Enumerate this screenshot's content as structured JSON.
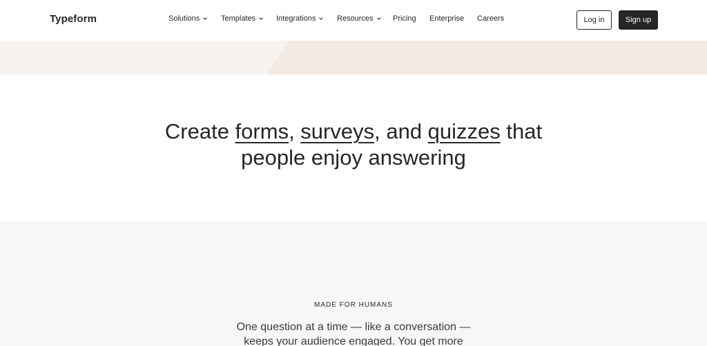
{
  "header": {
    "logo": "Typeform",
    "nav": [
      {
        "label": "Solutions",
        "dropdown": true
      },
      {
        "label": "Templates",
        "dropdown": true
      },
      {
        "label": "Integrations",
        "dropdown": true
      },
      {
        "label": "Resources",
        "dropdown": true
      },
      {
        "label": "Pricing",
        "dropdown": false
      },
      {
        "label": "Enterprise",
        "dropdown": false
      },
      {
        "label": "Careers",
        "dropdown": false
      }
    ],
    "login_label": "Log in",
    "signup_label": "Sign up"
  },
  "hero": {
    "headline": {
      "part1": "Create ",
      "link1": "forms",
      "part2": ", ",
      "link2": "surveys",
      "part3": ", and ",
      "link3": "quizzes",
      "part4": " that",
      "line2": "people enjoy answering"
    }
  },
  "section2": {
    "eyebrow": "MADE FOR HUMANS",
    "line1": "One question at a time — like a conversation —",
    "line2": "keeps your audience engaged. You get more"
  },
  "colors": {
    "text": "#262627",
    "band": "#f4eae3",
    "band_light": "#f7f2ee",
    "section_bg": "#f8f7f5",
    "signup_bg": "#262627"
  }
}
